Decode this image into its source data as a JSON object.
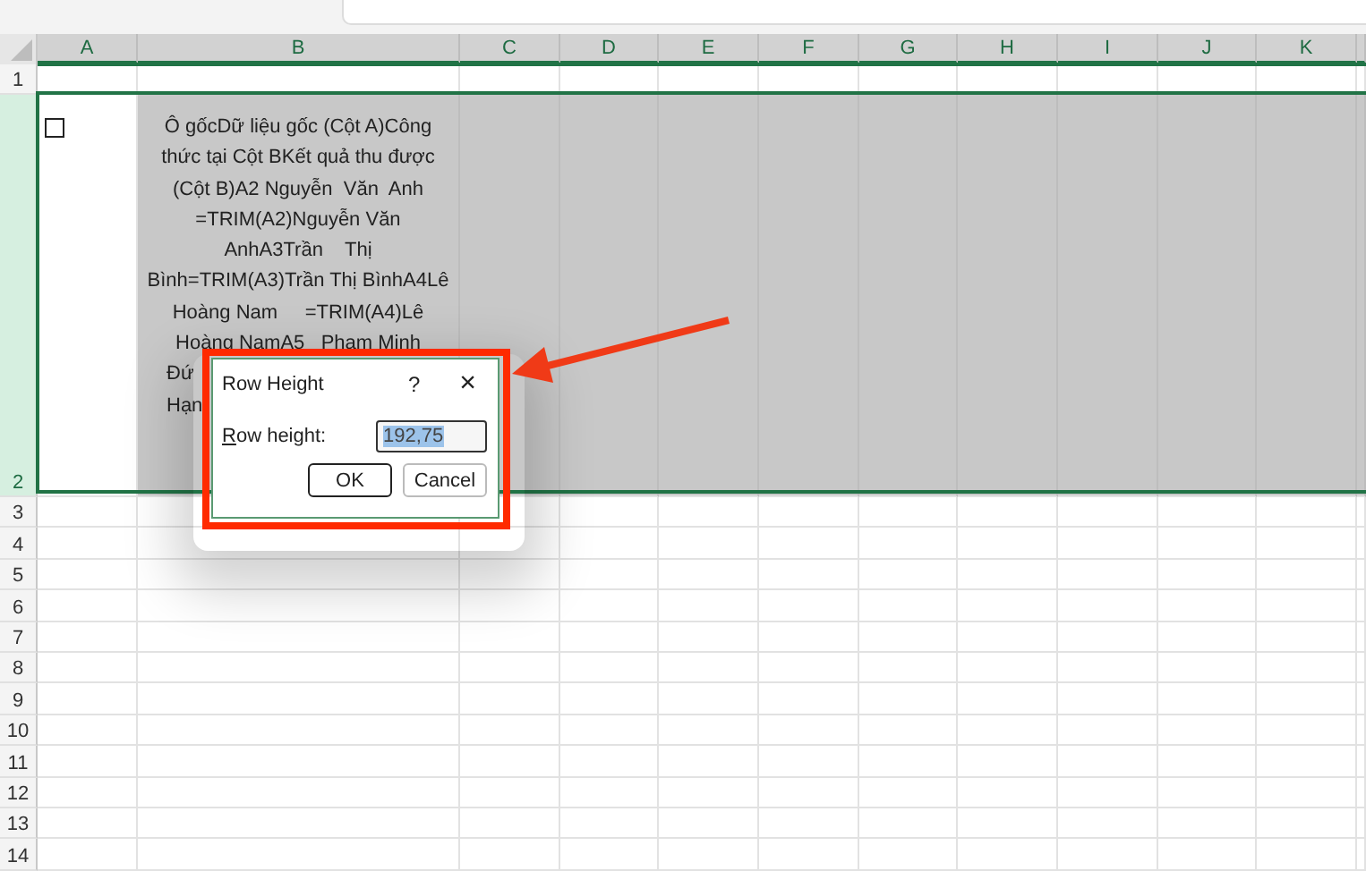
{
  "columns": [
    "A",
    "B",
    "C",
    "D",
    "E",
    "F",
    "G",
    "H",
    "I",
    "J",
    "K"
  ],
  "rows": [
    {
      "label": "1",
      "selected": false
    },
    {
      "label": "2",
      "selected": true
    },
    {
      "label": "3",
      "selected": false
    },
    {
      "label": "4",
      "selected": false
    },
    {
      "label": "5",
      "selected": false
    },
    {
      "label": "6",
      "selected": false
    },
    {
      "label": "7",
      "selected": false
    },
    {
      "label": "8",
      "selected": false
    },
    {
      "label": "9",
      "selected": false
    },
    {
      "label": "10",
      "selected": false
    },
    {
      "label": "11",
      "selected": false
    },
    {
      "label": "12",
      "selected": false
    },
    {
      "label": "13",
      "selected": false
    },
    {
      "label": "14",
      "selected": false
    }
  ],
  "cell_a2": {
    "checkbox": {
      "checked": false
    }
  },
  "cell_b2": {
    "lines": [
      {
        "text": "Ô gốcDữ liệu gốc (Cột A)Công",
        "kind": "full"
      },
      {
        "text": "thức tại Cột BKết quả thu được",
        "kind": "full"
      },
      {
        "text": "(Cột B)A2 Nguyễn  Văn  Anh",
        "kind": "full"
      },
      {
        "text": "=TRIM(A2)Nguyễn Văn",
        "kind": "full"
      },
      {
        "text": "AnhA3Trần    Thị",
        "kind": "full"
      },
      {
        "text": "Bình=TRIM(A3)Trần Thị BìnhA4Lê",
        "kind": "full"
      },
      {
        "text": "Hoàng Nam     =TRIM(A4)Lê",
        "kind": "full"
      },
      {
        "text": "Hoàng NamA5   Phạm Minh",
        "kind": "full"
      },
      {
        "text": "Đứ",
        "kind": "cut"
      },
      {
        "text": "Hạn",
        "kind": "cut"
      }
    ]
  },
  "dialog": {
    "title": "Row Height",
    "help": "?",
    "close": "×",
    "field_label": "Row height:",
    "value": "192,75",
    "value_selected": true,
    "buttons": [
      {
        "label": "OK",
        "default": true
      },
      {
        "label": "Cancel",
        "default": false
      }
    ]
  }
}
